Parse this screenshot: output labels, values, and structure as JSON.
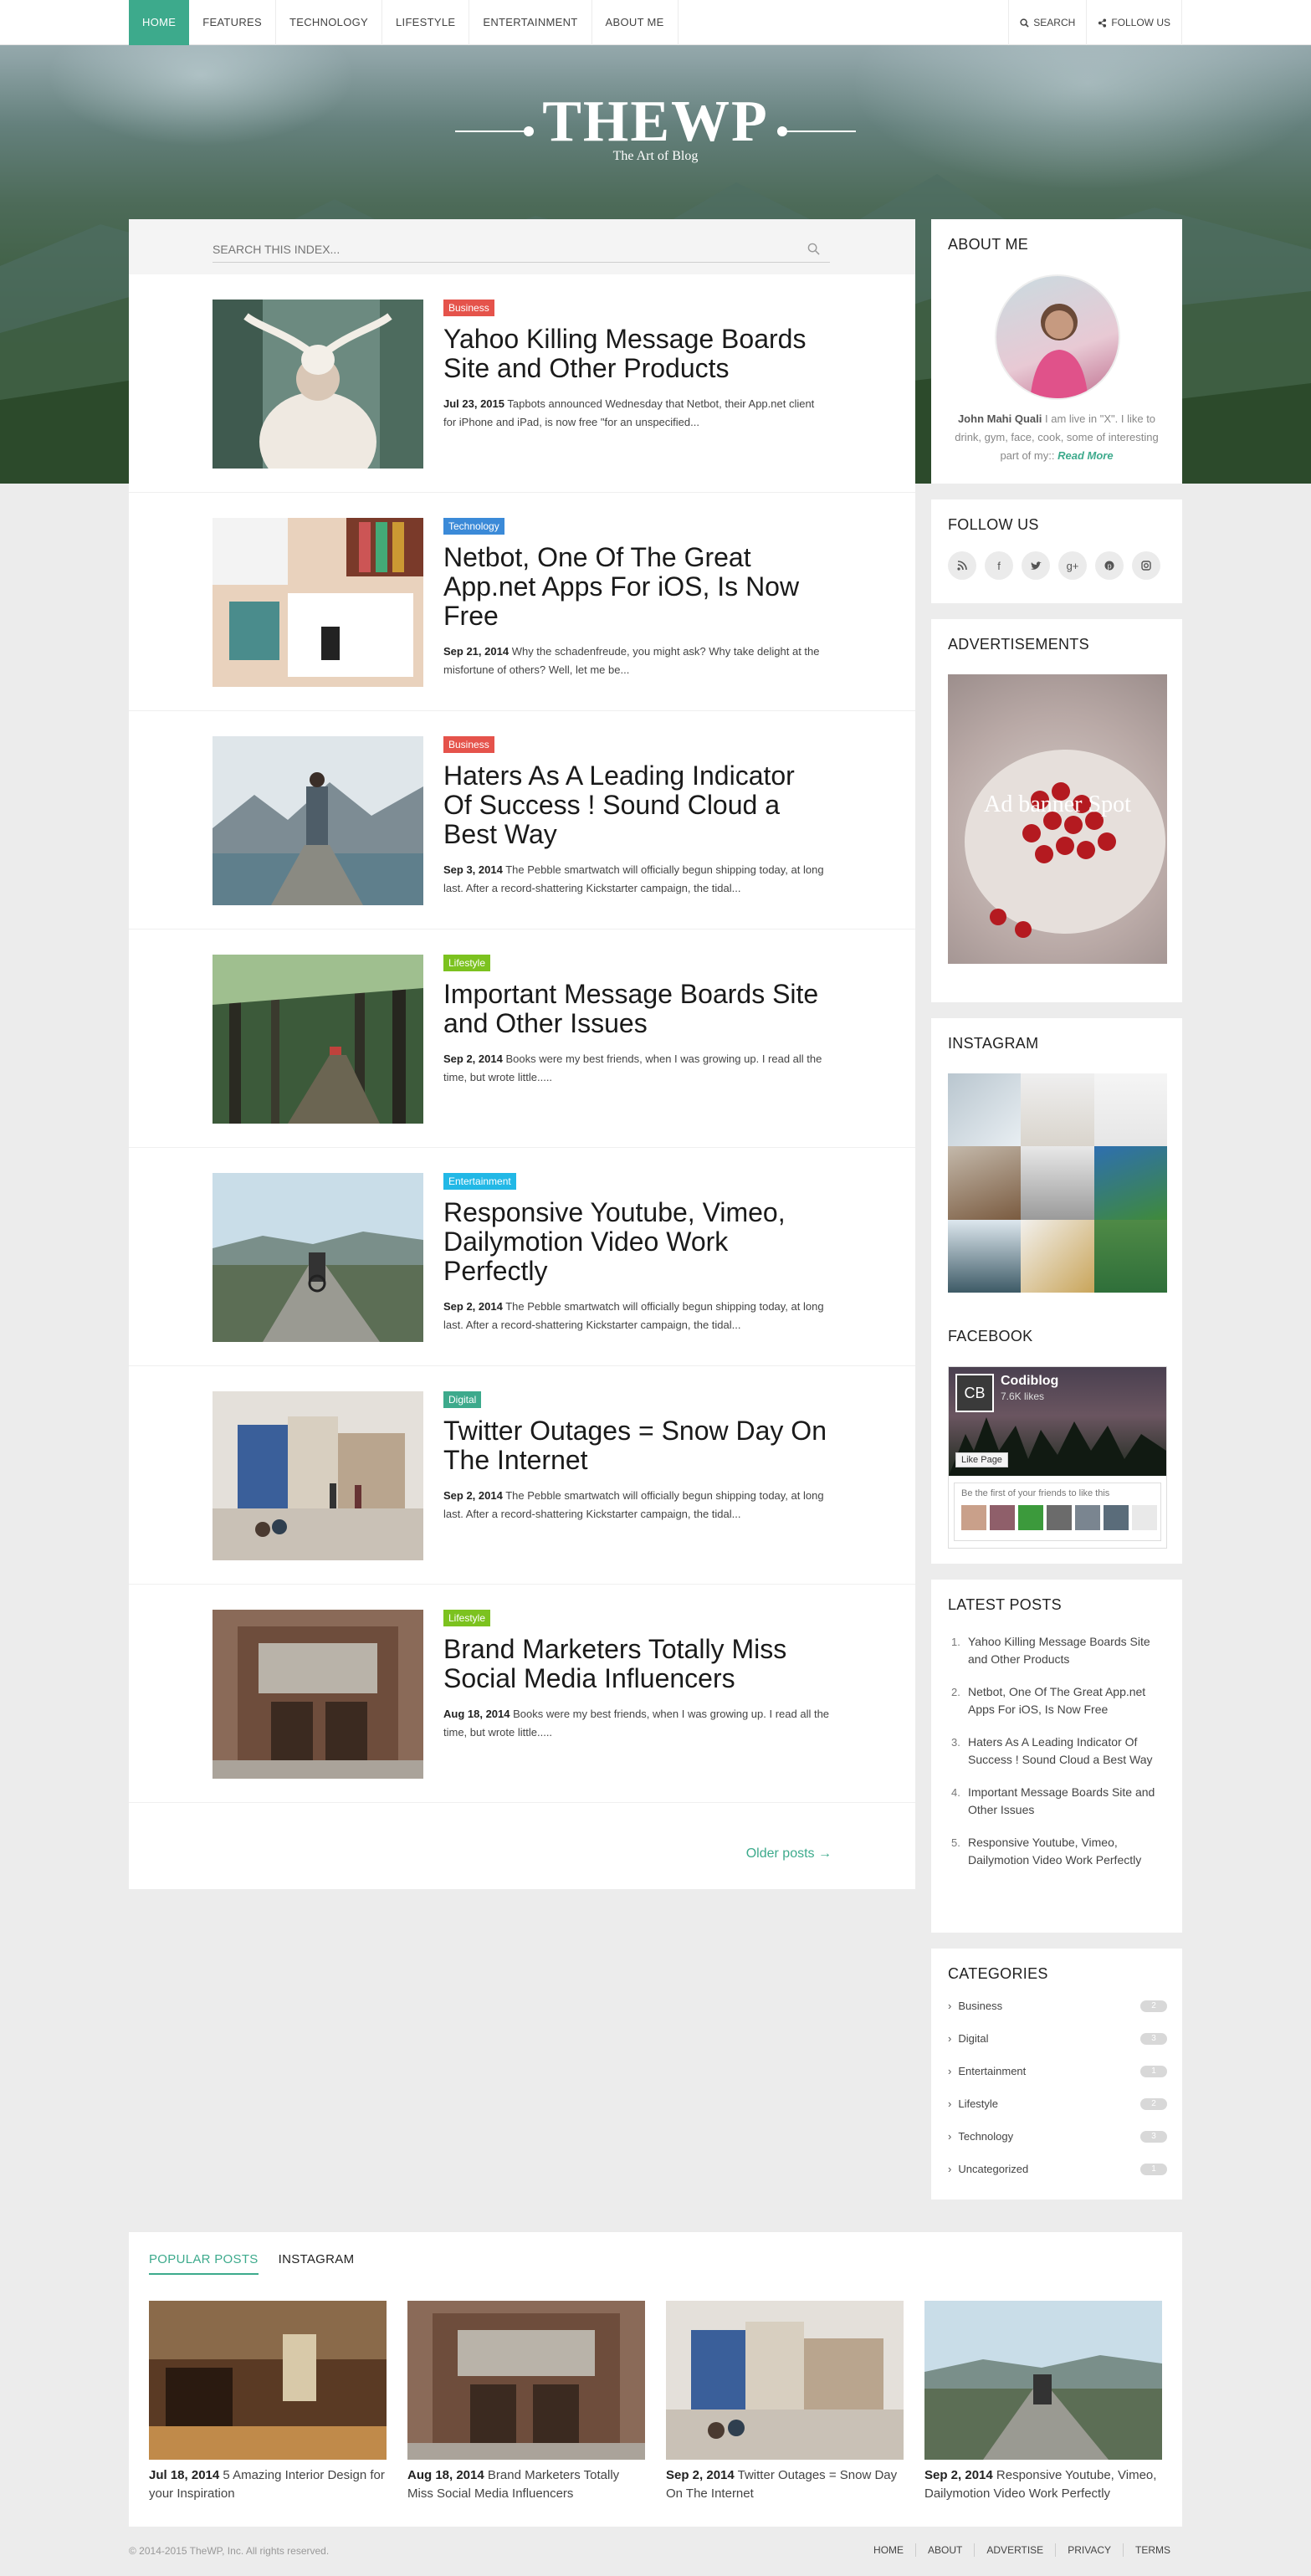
{
  "colors": {
    "accent": "#3daa8c",
    "business": "#e5534b",
    "technology": "#3b8ad8",
    "lifestyle": "#7cc21f",
    "entertainment": "#22b8e6",
    "digital": "#3daa8c"
  },
  "nav": {
    "items": [
      "HOME",
      "FEATURES",
      "TECHNOLOGY",
      "LIFESTYLE",
      "ENTERTAINMENT",
      "ABOUT ME"
    ],
    "search": "SEARCH",
    "follow": "FOLLOW US"
  },
  "logo": {
    "title": "THEWP",
    "tagline": "The Art of Blog"
  },
  "search": {
    "placeholder": "SEARCH THIS INDEX..."
  },
  "posts": [
    {
      "category": "Business",
      "title": "Yahoo Killing Message Boards Site and Other Products",
      "date": "Jul 23, 2015",
      "excerpt": "Tapbots announced Wednesday that Netbot, their App.net client for iPhone and iPad, is now free \"for an unspecified..."
    },
    {
      "category": "Technology",
      "title": "Netbot, One Of The Great App.net Apps For iOS, Is Now Free",
      "date": "Sep 21, 2014",
      "excerpt": "Why the schadenfreude, you might ask? Why take delight at the misfortune of others? Well, let me be..."
    },
    {
      "category": "Business",
      "title": "Haters As A Leading Indicator Of Success ! Sound Cloud a Best Way",
      "date": "Sep 3, 2014",
      "excerpt": "The Pebble smartwatch will officially begun shipping today, at long last. After a record-shattering Kickstarter campaign, the tidal..."
    },
    {
      "category": "Lifestyle",
      "title": "Important Message Boards Site and Other Issues",
      "date": "Sep 2, 2014",
      "excerpt": "Books were my best friends, when I was growing up. I read all the time, but wrote little....."
    },
    {
      "category": "Entertainment",
      "title": "Responsive Youtube, Vimeo, Dailymotion Video Work Perfectly",
      "date": "Sep 2, 2014",
      "excerpt": "The Pebble smartwatch will officially begun shipping today, at long last. After a record-shattering Kickstarter campaign, the tidal..."
    },
    {
      "category": "Digital",
      "title": "Twitter Outages = Snow Day On The Internet",
      "date": "Sep 2, 2014",
      "excerpt": "The Pebble smartwatch will officially begun shipping today, at long last. After a record-shattering Kickstarter campaign, the tidal..."
    },
    {
      "category": "Lifestyle",
      "title": "Brand Marketers Totally Miss Social Media Influencers",
      "date": "Aug 18, 2014",
      "excerpt": "Books were my best friends, when I was growing up. I read all the time, but wrote little....."
    }
  ],
  "older_posts": "Older posts →",
  "about": {
    "title": "ABOUT ME",
    "name": "John Mahi Quali",
    "text": "I am live in \"X\". I like to drink, gym, face, cook, some of interesting part of my::",
    "read_more": "Read More"
  },
  "follow": {
    "title": "FOLLOW US",
    "icons": [
      "rss-icon",
      "facebook-icon",
      "twitter-icon",
      "googleplus-icon",
      "pinterest-icon",
      "instagram-icon"
    ]
  },
  "ads": {
    "title": "ADVERTISEMENTS",
    "banner": "Ad banner Spot"
  },
  "instagram": {
    "title": "INSTAGRAM"
  },
  "facebook": {
    "title": "FACEBOOK",
    "page": "Codiblog",
    "initials": "CB",
    "likes": "7.6K likes",
    "like_button": "Like Page",
    "friends_text": "Be the first of your friends to like this"
  },
  "latest": {
    "title": "LATEST POSTS",
    "items": [
      "Yahoo Killing Message Boards Site and Other Products",
      "Netbot, One Of The Great App.net Apps For iOS, Is Now Free",
      "Haters As A Leading Indicator Of Success ! Sound Cloud a Best Way",
      "Important Message Boards Site and Other Issues",
      "Responsive Youtube, Vimeo, Dailymotion Video Work Perfectly"
    ]
  },
  "categories": {
    "title": "CATEGORIES",
    "items": [
      {
        "name": "Business",
        "count": "2"
      },
      {
        "name": "Digital",
        "count": "3"
      },
      {
        "name": "Entertainment",
        "count": "1"
      },
      {
        "name": "Lifestyle",
        "count": "2"
      },
      {
        "name": "Technology",
        "count": "3"
      },
      {
        "name": "Uncategorized",
        "count": "1"
      }
    ]
  },
  "popular": {
    "tabs": [
      "POPULAR POSTS",
      "INSTAGRAM"
    ],
    "items": [
      {
        "date": "Jul 18, 2014",
        "title": "5 Amazing Interior Design for your Inspiration"
      },
      {
        "date": "Aug 18, 2014",
        "title": "Brand Marketers Totally Miss Social Media Influencers"
      },
      {
        "date": "Sep 2, 2014",
        "title": "Twitter Outages = Snow Day On The Internet"
      },
      {
        "date": "Sep 2, 2014",
        "title": "Responsive Youtube, Vimeo, Dailymotion Video Work Perfectly"
      }
    ]
  },
  "footer": {
    "copyright": "© 2014-2015 TheWP, Inc. All rights reserved.",
    "links": [
      "HOME",
      "ABOUT",
      "ADVERTISE",
      "PRIVACY",
      "TERMS"
    ]
  }
}
